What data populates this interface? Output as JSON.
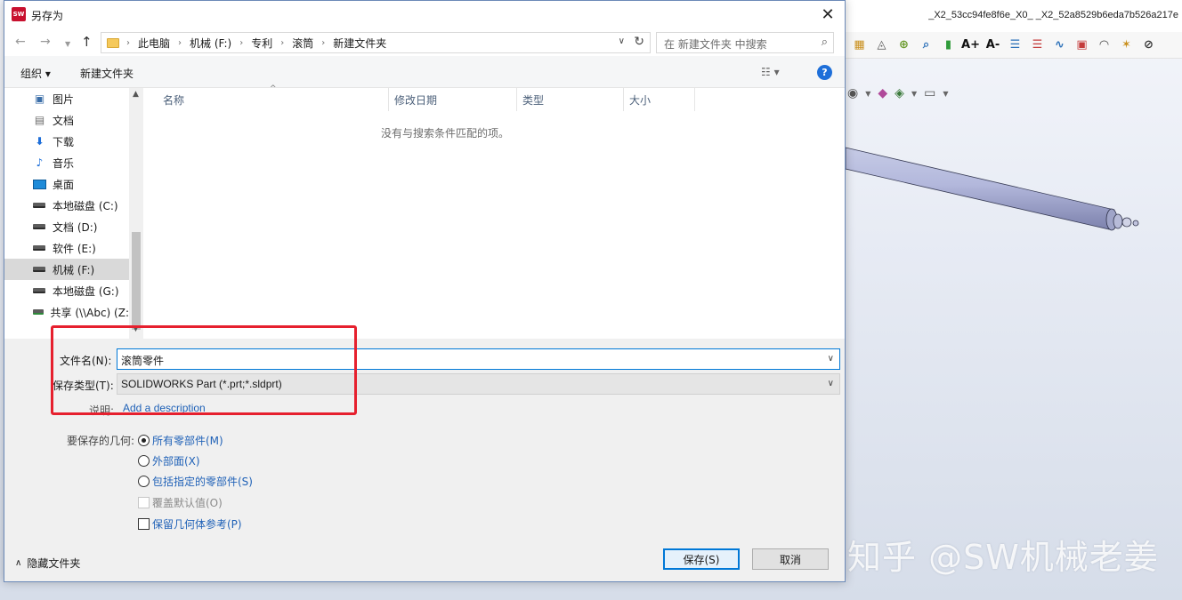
{
  "app": {
    "title": "_X2_53cc94fe8f6e_X0_ _X2_52a8529b6eda7b526a217e",
    "watermark": "知乎 @SW机械老姜"
  },
  "dialog": {
    "title": "另存为",
    "icon_text": "SW"
  },
  "address": {
    "breadcrumbs": [
      "此电脑",
      "机械 (F:)",
      "专利",
      "滚筒",
      "新建文件夹"
    ]
  },
  "search": {
    "placeholder": "在 新建文件夹 中搜索"
  },
  "toolbar": {
    "organize_label": "组织 ▾",
    "new_folder_label": "新建文件夹"
  },
  "nav": {
    "items": [
      {
        "label": "图片",
        "icon": "pictures-icon"
      },
      {
        "label": "文档",
        "icon": "documents-icon"
      },
      {
        "label": "下载",
        "icon": "download-icon"
      },
      {
        "label": "音乐",
        "icon": "music-icon"
      },
      {
        "label": "桌面",
        "icon": "desktop-icon"
      },
      {
        "label": "本地磁盘 (C:)",
        "icon": "drive-icon"
      },
      {
        "label": "文档 (D:)",
        "icon": "drive-icon"
      },
      {
        "label": "软件 (E:)",
        "icon": "drive-icon"
      },
      {
        "label": "机械 (F:)",
        "icon": "drive-icon"
      },
      {
        "label": "本地磁盘 (G:)",
        "icon": "drive-icon"
      },
      {
        "label": "共享 (\\\\Abc) (Z:",
        "icon": "network-drive-icon"
      }
    ],
    "selected_index": 8
  },
  "file_list": {
    "columns": [
      "名称",
      "修改日期",
      "类型",
      "大小"
    ],
    "empty_message": "没有与搜索条件匹配的项。"
  },
  "form": {
    "filename_label": "文件名(N):",
    "filename_value": "滚筒零件",
    "savetype_label": "保存类型(T):",
    "savetype_value": "SOLIDWORKS Part (*.prt;*.sldprt)",
    "description_label": "说明:",
    "description_link": "Add a description"
  },
  "options": {
    "label": "要保存的几何:",
    "all_components": "所有零部件(M)",
    "exterior": "外部面(X)",
    "specified_components": "包括指定的零部件(S)",
    "override_defaults": "覆盖默认值(O)",
    "keep_geometry_ref": "保留几何体参考(P)"
  },
  "buttons": {
    "hide_folders": "隐藏文件夹",
    "save": "保存(S)",
    "cancel": "取消"
  },
  "colors": {
    "accent": "#0078d7",
    "link": "#1f61b7",
    "highlight": "#e6202e"
  }
}
